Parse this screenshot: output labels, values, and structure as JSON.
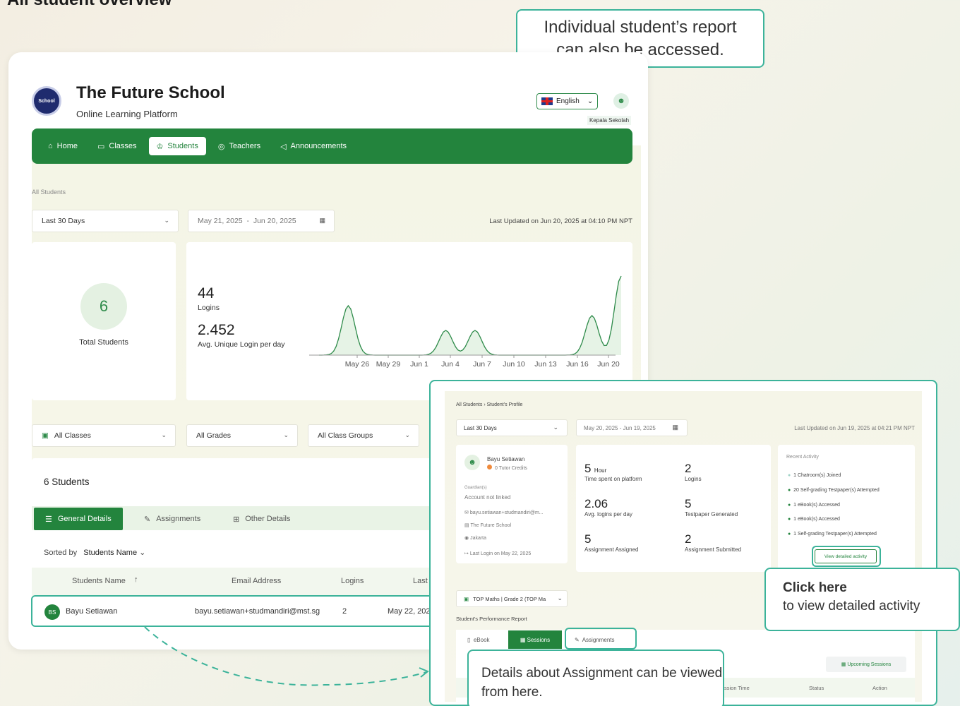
{
  "page_title": "All student overview",
  "callouts": {
    "top": "Individual student’s report can also be accessed.",
    "click_title": "Click here",
    "click_sub": "to view detailed activity",
    "assign": "Details about Assignment can be viewed from here."
  },
  "school": {
    "name": "The Future School",
    "subtitle": "Online Learning Platform",
    "logo_text": "School"
  },
  "language": "English",
  "user_role": "Kepala Sekolah",
  "nav": [
    "Home",
    "Classes",
    "Students",
    "Teachers",
    "Announcements"
  ],
  "breadcrumb": "All Students",
  "period": "Last 30 Days",
  "date_range": {
    "start": "May 21, 2025",
    "sep": "-",
    "end": "Jun 20, 2025"
  },
  "last_updated": "Last Updated on Jun 20, 2025 at 04:10 PM NPT",
  "total_students": {
    "value": "6",
    "label": "Total Students"
  },
  "logins": {
    "value": "44",
    "label": "Logins"
  },
  "avg_login": {
    "value": "2.452",
    "label": "Avg. Unique Login per day"
  },
  "chart_data": {
    "type": "area",
    "x": [
      "May 26",
      "May 29",
      "Jun 1",
      "Jun 4",
      "Jun 7",
      "Jun 10",
      "Jun 13",
      "Jun 16",
      "Jun 20"
    ],
    "x_index": [
      0,
      1,
      2,
      3,
      4,
      5,
      6,
      7,
      8,
      9,
      10,
      11,
      12,
      13,
      14,
      15,
      16,
      17,
      18,
      19,
      20,
      21,
      22,
      23,
      24,
      25,
      26,
      27,
      28,
      29,
      30
    ],
    "y": [
      0,
      0,
      0,
      0,
      0,
      0,
      0,
      0,
      0,
      0,
      0,
      0,
      0,
      0,
      0,
      0,
      0,
      0,
      0,
      0,
      0,
      0,
      0,
      0,
      0,
      0,
      0,
      0,
      0,
      0,
      0
    ],
    "peaks": [
      {
        "x": 3,
        "y": 5
      },
      {
        "x": 13,
        "y": 2.5
      },
      {
        "x": 16,
        "y": 2.5
      },
      {
        "x": 28,
        "y": 4
      },
      {
        "x": 31,
        "y": 8
      }
    ],
    "color": "#2e8b4a"
  },
  "filters": [
    "All Classes",
    "All Grades",
    "All Class Groups"
  ],
  "students_count": "6 Students",
  "tabs": [
    "General Details",
    "Assignments",
    "Other Details"
  ],
  "sorted_by": {
    "label": "Sorted by",
    "value": "Students Name"
  },
  "table": {
    "headers": [
      "Students Name",
      "Email Address",
      "Logins",
      "Last"
    ],
    "rows": [
      {
        "initials": "BS",
        "name": "Bayu Setiawan",
        "email": "bayu.setiawan+studmandiri@mst.sg",
        "logins": "2",
        "last": "May 22, 202"
      }
    ]
  },
  "profile": {
    "crumb1": "All Students",
    "crumb2": "Student's Profile",
    "period": "Last 30 Days",
    "date_range": "May 20, 2025  -  Jun 19, 2025",
    "updated": "Last Updated on Jun 19, 2025 at 04:21 PM NPT",
    "name": "Bayu Setiawan",
    "credits": "0 Tutor Credits",
    "guardian_label": "Guardian(s)",
    "guardian": "Account not linked",
    "email": "bayu.setiawan+studmandiri@m...",
    "school": "The Future School",
    "city": "Jakarta",
    "last_login": "Last Login on May 22, 2025",
    "stats": [
      {
        "value": "5",
        "unit": "Hour",
        "label": "Time spent on platform"
      },
      {
        "value": "2",
        "unit": "",
        "label": "Logins"
      },
      {
        "value": "2.06",
        "unit": "",
        "label": "Avg. logins per day"
      },
      {
        "value": "5",
        "unit": "",
        "label": "Testpaper Generated"
      },
      {
        "value": "5",
        "unit": "",
        "label": "Assignment Assigned"
      },
      {
        "value": "2",
        "unit": "",
        "label": "Assignment Submitted"
      }
    ],
    "recent_title": "Recent Activity",
    "recent": [
      "1 Chatroom(s) Joined",
      "20 Self-grading Testpaper(s) Attempted",
      "1 eBook(s) Accessed",
      "1 eBook(s) Accessed",
      "1 Self-grading Testpaper(s) Attempted"
    ],
    "view_btn": "View detailed activity",
    "class_sel": "TOP Maths | Grade 2 (TOP Ma",
    "report_title": "Student's Performance Report",
    "tabs": [
      "eBook",
      "Sessions",
      "Assignments"
    ],
    "upcoming": "Upcoming Sessions",
    "cols": [
      "ssion Time",
      "Status",
      "Action"
    ]
  }
}
